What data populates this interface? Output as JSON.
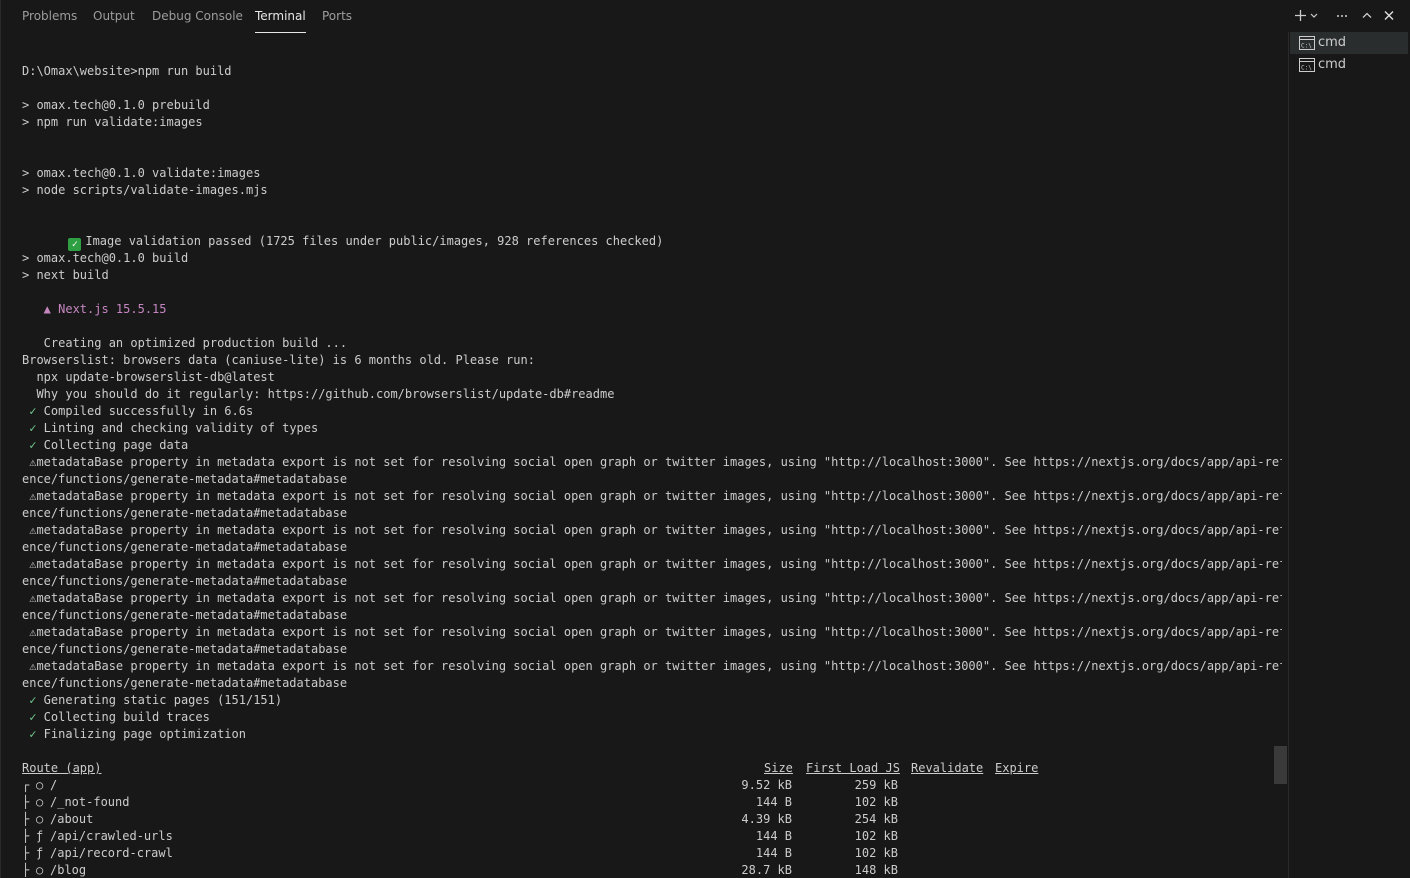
{
  "tabs": [
    {
      "label": "Problems",
      "active": false
    },
    {
      "label": "Output",
      "active": false
    },
    {
      "label": "Debug Console",
      "active": false
    },
    {
      "label": "Terminal",
      "active": true
    },
    {
      "label": "Ports",
      "active": false
    }
  ],
  "actions": {
    "new_terminal_icon": "plus-icon",
    "dropdown_icon": "chevron-down-icon",
    "more_icon": "ellipsis-icon",
    "maximize_icon": "chevron-up-icon",
    "close_icon": "close-icon"
  },
  "terminal_list": [
    {
      "label": "cmd",
      "icon": "terminal-cmd-icon",
      "active": true
    },
    {
      "label": "cmd",
      "icon": "terminal-cmd-icon",
      "active": false
    }
  ],
  "colors": {
    "background": "#181818",
    "text": "#cccccc",
    "nextjs": "#c586c0",
    "check": "#73c991",
    "validation_badge": "#2ea043"
  },
  "output": {
    "l01": "",
    "l02": "D:\\Omax\\website>npm run build",
    "l03": "",
    "l04": "> omax.tech@0.1.0 prebuild",
    "l05": "> npm run validate:images",
    "l06": "",
    "l07": "",
    "l08": "> omax.tech@0.1.0 validate:images",
    "l09": "> node scripts/validate-images.mjs",
    "l10": "",
    "l11_badge": "✓",
    "l11": "Image validation passed (1725 files under public/images, 928 references checked)",
    "l12": "",
    "l13": "> omax.tech@0.1.0 build",
    "l14": "> next build",
    "l15": "",
    "l16": "   ▲ Next.js 15.5.15",
    "l17": "",
    "l18": "   Creating an optimized production build ...",
    "l19": "Browserslist: browsers data (caniuse-lite) is 6 months old. Please run:",
    "l20": "  npx update-browserslist-db@latest",
    "l21": "  Why you should do it regularly: https://github.com/browserslist/update-db#readme",
    "check_mark": " ✓",
    "l22": " Compiled successfully in 6.6s",
    "l23": " Linting and checking validity of types",
    "l24": " Collecting page data",
    "warn_line_a": " ⚠metadataBase property in metadata export is not set for resolving social open graph or twitter images, using \"http://localhost:3000\". See https://nextjs.org/docs/app/api-refer",
    "warn_line_b": "ence/functions/generate-metadata#metadatabase",
    "l39": " Generating static pages (151/151)",
    "l40": " Collecting build traces",
    "l41": " Finalizing page optimization"
  },
  "routes": {
    "headers": {
      "route": "Route (app)",
      "size": "Size",
      "first_load": "First Load JS",
      "revalidate": "Revalidate",
      "expire": "Expire"
    },
    "rows": [
      {
        "tree": "┌",
        "type": "○",
        "path": "/",
        "size": "9.52 kB",
        "first_load": "259 kB"
      },
      {
        "tree": "├",
        "type": "○",
        "path": "/_not-found",
        "size": "144 B",
        "first_load": "102 kB"
      },
      {
        "tree": "├",
        "type": "○",
        "path": "/about",
        "size": "4.39 kB",
        "first_load": "254 kB"
      },
      {
        "tree": "├",
        "type": "ƒ",
        "path": "/api/crawled-urls",
        "size": "144 B",
        "first_load": "102 kB"
      },
      {
        "tree": "├",
        "type": "ƒ",
        "path": "/api/record-crawl",
        "size": "144 B",
        "first_load": "102 kB"
      },
      {
        "tree": "├",
        "type": "○",
        "path": "/blog",
        "size": "28.7 kB",
        "first_load": "148 kB"
      }
    ]
  }
}
